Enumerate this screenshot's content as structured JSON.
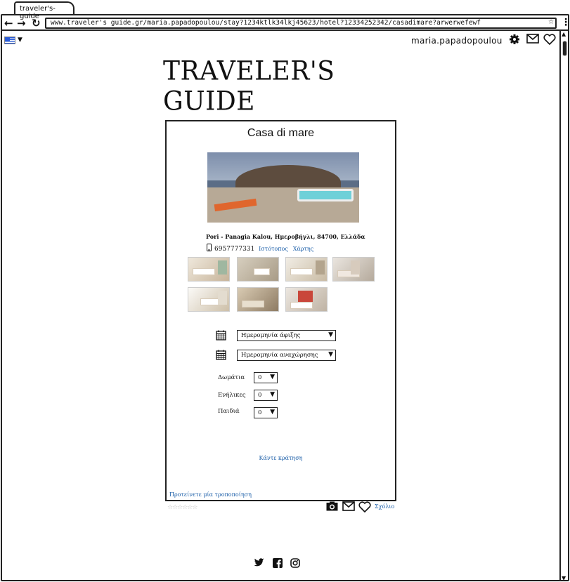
{
  "browser": {
    "tab_title": "traveler's-guide",
    "url": "www.traveler's guide.gr/maria.papadopoulou/stay?1234ktlk34lkj45623/hotel?12334252342/casadimare?arwerwefewf",
    "back_glyph": "←",
    "forward_glyph": "→",
    "reload_glyph": "↻",
    "bookmark_glyph": "☆",
    "menu_glyph": "⋮"
  },
  "header": {
    "language_flag": "greece-flag-icon",
    "username": "maria.papadopoulou",
    "icons": [
      "gear-icon",
      "mail-icon",
      "heart-icon"
    ]
  },
  "brand": {
    "logo_text": "Traveler's Guide"
  },
  "hotel": {
    "name": "Casa di mare",
    "address": "Pori - Panagia Kalou, Ημεροβήγλι, 84700, Ελλάδα",
    "phone": "6957777331",
    "website_label": "Ιστότοπος",
    "map_label": "Χάρτης"
  },
  "booking": {
    "arrival_placeholder": "Ημερομηνία άφιξης",
    "departure_placeholder": "Ημερομηνία αναχώρησης",
    "rooms_label": "Δωμάτια",
    "rooms_value": "0",
    "adults_label": "Ενήλικες",
    "adults_value": "0",
    "children_label": "Παιδιά",
    "children_value": "0",
    "book_label": "Κάντε κράτηση"
  },
  "suggest_label": "Προτείνετε μία τροποποίηση",
  "rating": {
    "stars": "☆☆☆☆☆☆",
    "value": 0
  },
  "actions": {
    "comment_label": "Σχόλιο"
  },
  "footer": {
    "social": [
      "twitter-icon",
      "facebook-icon",
      "instagram-icon"
    ]
  }
}
